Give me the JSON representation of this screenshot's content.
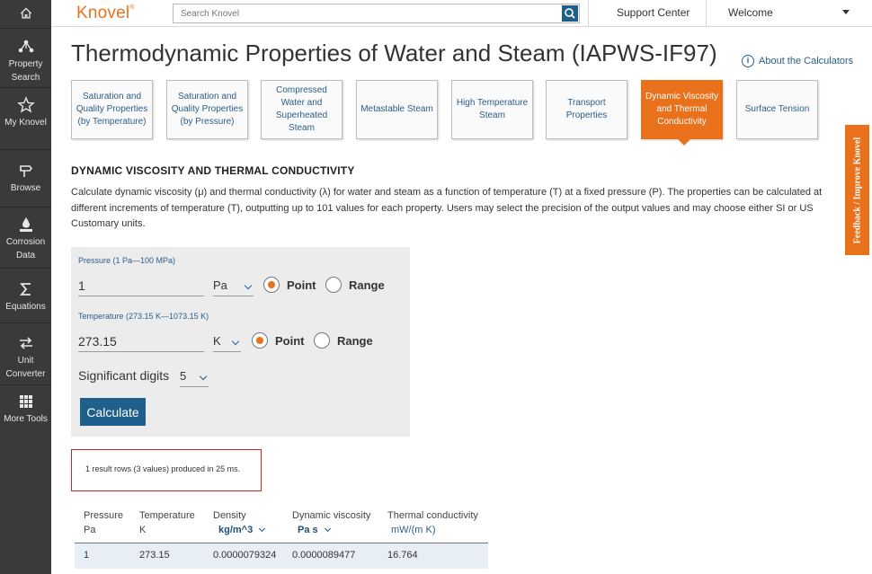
{
  "sidebar": {
    "items": [
      {
        "icon": "home-icon",
        "label": ""
      },
      {
        "icon": "property-search-icon",
        "label": "Property Search"
      },
      {
        "icon": "star-icon",
        "label": "My Knovel"
      },
      {
        "icon": "browse-icon",
        "label": "Browse"
      },
      {
        "icon": "corrosion-icon",
        "label": "Corrosion Data"
      },
      {
        "icon": "sigma-icon",
        "label": "Equations"
      },
      {
        "icon": "unit-converter-icon",
        "label": "Unit Converter"
      },
      {
        "icon": "grid-icon",
        "label": "More Tools"
      }
    ]
  },
  "header": {
    "logo": "Knovel",
    "logo_mark": "®",
    "search_placeholder": "Search Knovel",
    "support": "Support Center",
    "welcome": "Welcome"
  },
  "page": {
    "title": "Thermodynamic Properties of Water and Steam (IAPWS-IF97)",
    "about": "About the Calculators"
  },
  "tabs": [
    {
      "label": "Saturation and Quality Properties (by Temperature)",
      "active": false
    },
    {
      "label": "Saturation and Quality Properties (by Pressure)",
      "active": false
    },
    {
      "label": "Compressed Water and Superheated Steam",
      "active": false
    },
    {
      "label": "Metastable Steam",
      "active": false
    },
    {
      "label": "High Temperature Steam",
      "active": false
    },
    {
      "label": "Transport Properties",
      "active": false
    },
    {
      "label": "Dynamic Viscosity and Thermal Conductivity",
      "active": true
    },
    {
      "label": "Surface Tension",
      "active": false
    }
  ],
  "feedback": "Feedback / Improve Knovel",
  "section": {
    "title": "DYNAMIC VISCOSITY AND THERMAL CONDUCTIVITY",
    "description": "Calculate dynamic viscosity (μ) and thermal conductivity (λ) for water and steam as a function of temperature (T) at a fixed pressure (P). The properties can be calculated at different increments of temperature (T), outputting up to 101 values for each property. Users may select the precision of the output values and may choose either SI or US Customary units."
  },
  "form": {
    "pressure": {
      "label": "Pressure (1 Pa—100 MPa)",
      "value": "1",
      "unit": "Pa",
      "mode_point": "Point",
      "mode_range": "Range",
      "selected": "Point"
    },
    "temperature": {
      "label": "Temperature (273.15 K—1073.15 K)",
      "value": "273.15",
      "unit": "K",
      "mode_point": "Point",
      "mode_range": "Range",
      "selected": "Point"
    },
    "sig_digits": {
      "label": "Significant digits",
      "value": "5"
    },
    "calculate": "Calculate"
  },
  "result": {
    "summary": "1 result rows (3 values) produced in 25 ms.",
    "headers": [
      {
        "name": "Pressure",
        "unit": "Pa",
        "selectable": false
      },
      {
        "name": "Temperature",
        "unit": "K",
        "selectable": false
      },
      {
        "name": "Density",
        "unit": "kg/m^3",
        "selectable": true
      },
      {
        "name": "Dynamic viscosity",
        "unit": "Pa s",
        "selectable": true
      },
      {
        "name": "Thermal conductivity",
        "unit": "mW/(m K)",
        "selectable": false
      }
    ],
    "rows": [
      [
        "1",
        "273.15",
        "0.0000079324",
        "0.0000089477",
        "16.764"
      ]
    ]
  },
  "colors": {
    "accent": "#e9711c",
    "primary": "#1f5f8b",
    "link": "#2a5d8a",
    "sidebar": "#3a3a3a",
    "highlight": "#c62828"
  }
}
